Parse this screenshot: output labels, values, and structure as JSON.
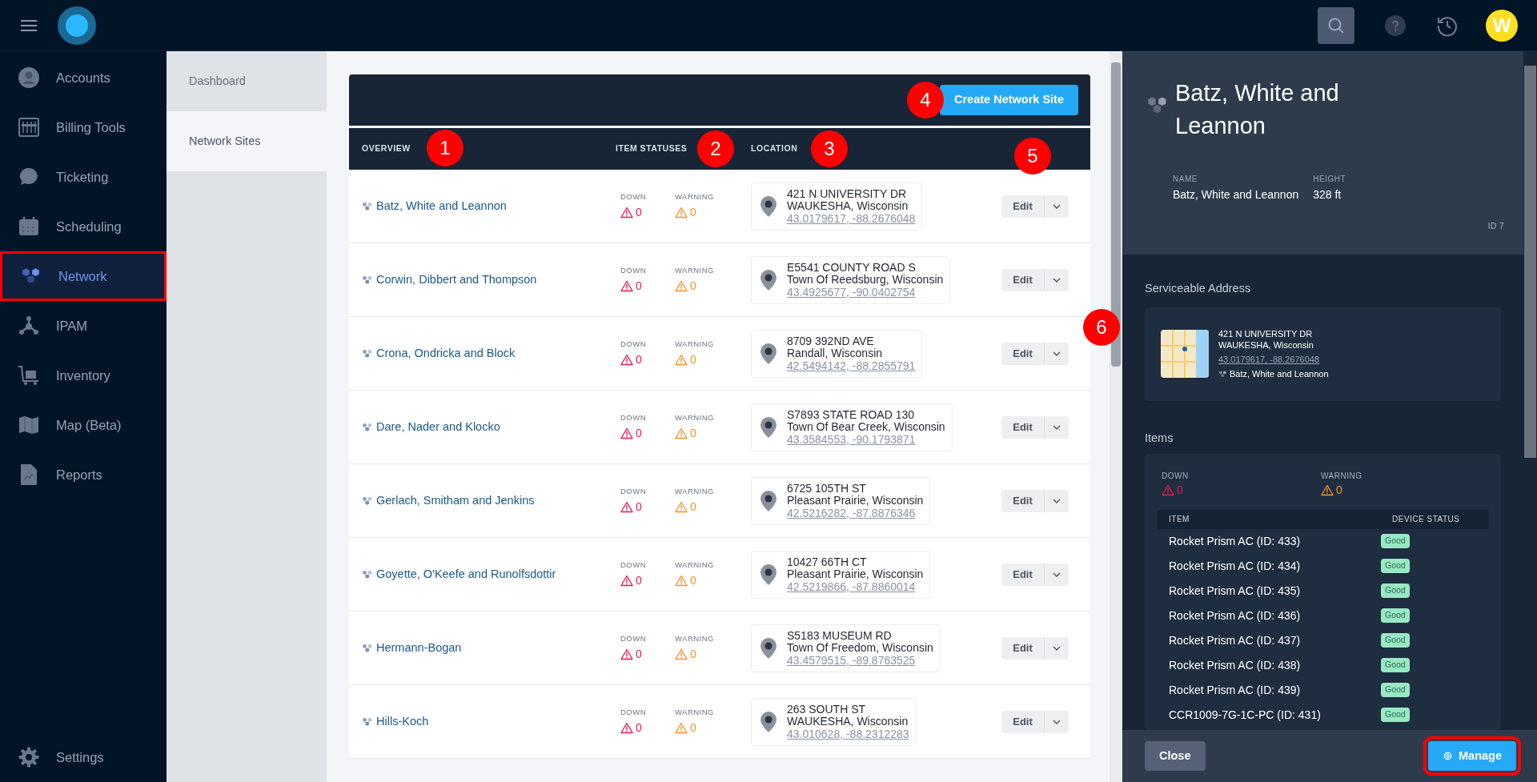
{
  "top_bar": {
    "avatar_initial": "W"
  },
  "sidebar": {
    "items": [
      {
        "kind": "accounts",
        "label": "Accounts",
        "selected": false,
        "annotated": false
      },
      {
        "kind": "billing",
        "label": "Billing Tools",
        "selected": false,
        "annotated": false
      },
      {
        "kind": "ticketing",
        "label": "Ticketing",
        "selected": false,
        "annotated": false
      },
      {
        "kind": "scheduling",
        "label": "Scheduling",
        "selected": false,
        "annotated": false
      },
      {
        "kind": "network",
        "label": "Network",
        "selected": true,
        "annotated": true
      },
      {
        "kind": "ipam",
        "label": "IPAM",
        "selected": false,
        "annotated": false
      },
      {
        "kind": "inventory",
        "label": "Inventory",
        "selected": false,
        "annotated": false
      },
      {
        "kind": "map",
        "label": "Map (Beta)",
        "selected": false,
        "annotated": false
      },
      {
        "kind": "reports",
        "label": "Reports",
        "selected": false,
        "annotated": false
      }
    ],
    "footer_item": {
      "kind": "settings",
      "label": "Settings"
    }
  },
  "subnav": {
    "items": [
      {
        "label": "Dashboard",
        "selected": false
      },
      {
        "label": "Network Sites",
        "selected": true
      }
    ]
  },
  "toolbar": {
    "create_button": "Create Network Site"
  },
  "table": {
    "columns": [
      "OVERVIEW",
      "ITEM STATUSES",
      "LOCATION"
    ],
    "rows": [
      {
        "name": "Batz, White and Leannon",
        "statuses": [
          {
            "kind": "down",
            "label": "DOWN",
            "count": "0"
          },
          {
            "kind": "warning",
            "label": "WARNING",
            "count": "0"
          }
        ],
        "address": [
          "421 N UNIVERSITY DR",
          "WAUKESHA, Wisconsin"
        ],
        "coordinates": "43.0179617, -88.2676048",
        "edit": "Edit"
      },
      {
        "name": "Corwin, Dibbert and Thompson",
        "statuses": [
          {
            "kind": "down",
            "label": "DOWN",
            "count": "0"
          },
          {
            "kind": "warning",
            "label": "WARNING",
            "count": "0"
          }
        ],
        "address": [
          "E5541 COUNTY ROAD S",
          "Town Of Reedsburg, Wisconsin"
        ],
        "coordinates": "43.4925677, -90.0402754",
        "edit": "Edit"
      },
      {
        "name": "Crona, Ondricka and Block",
        "statuses": [
          {
            "kind": "down",
            "label": "DOWN",
            "count": "0"
          },
          {
            "kind": "warning",
            "label": "WARNING",
            "count": "0"
          }
        ],
        "address": [
          "8709 392ND AVE",
          "Randall, Wisconsin"
        ],
        "coordinates": "42.5494142, -88.2855791",
        "edit": "Edit"
      },
      {
        "name": "Dare, Nader and Klocko",
        "statuses": [
          {
            "kind": "down",
            "label": "DOWN",
            "count": "0"
          },
          {
            "kind": "warning",
            "label": "WARNING",
            "count": "0"
          }
        ],
        "address": [
          "S7893 STATE ROAD 130",
          "Town Of Bear Creek, Wisconsin"
        ],
        "coordinates": "43.3584553, -90.1793871",
        "edit": "Edit"
      },
      {
        "name": "Gerlach, Smitham and Jenkins",
        "statuses": [
          {
            "kind": "down",
            "label": "DOWN",
            "count": "0"
          },
          {
            "kind": "warning",
            "label": "WARNING",
            "count": "0"
          }
        ],
        "address": [
          "6725 105TH ST",
          "Pleasant Prairie, Wisconsin"
        ],
        "coordinates": "42.5216282, -87.8876346",
        "edit": "Edit"
      },
      {
        "name": "Goyette, O'Keefe and Runolfsdottir",
        "statuses": [
          {
            "kind": "down",
            "label": "DOWN",
            "count": "0"
          },
          {
            "kind": "warning",
            "label": "WARNING",
            "count": "0"
          }
        ],
        "address": [
          "10427 66TH CT",
          "Pleasant Prairie, Wisconsin"
        ],
        "coordinates": "42.5219866, -87.8860014",
        "edit": "Edit"
      },
      {
        "name": "Hermann-Bogan",
        "statuses": [
          {
            "kind": "down",
            "label": "DOWN",
            "count": "0"
          },
          {
            "kind": "warning",
            "label": "WARNING",
            "count": "0"
          }
        ],
        "address": [
          "S5183 MUSEUM RD",
          "Town Of Freedom, Wisconsin"
        ],
        "coordinates": "43.4579515, -89.8763525",
        "edit": "Edit"
      },
      {
        "name": "Hills-Koch",
        "statuses": [
          {
            "kind": "down",
            "label": "DOWN",
            "count": "0"
          },
          {
            "kind": "warning",
            "label": "WARNING",
            "count": "0"
          }
        ],
        "address": [
          "263 SOUTH ST",
          "WAUKESHA, Wisconsin"
        ],
        "coordinates": "43.010628, -88.2312283",
        "edit": "Edit"
      }
    ]
  },
  "callouts": [
    "1",
    "2",
    "3",
    "4",
    "5",
    "6"
  ],
  "detail_panel": {
    "title": "Batz, White and Leannon",
    "fields": [
      {
        "label": "NAME",
        "value": "Batz, White and Leannon"
      },
      {
        "label": "HEIGHT",
        "value": "328 ft"
      }
    ],
    "id": "ID 7",
    "address_section": {
      "heading": "Serviceable Address",
      "lines": [
        "421 N UNIVERSITY DR",
        "WAUKESHA, Wisconsin"
      ],
      "coordinates": "43.0179617, -88.2676048",
      "site": "Batz, White and Leannon"
    },
    "items_section": {
      "heading": "Items",
      "statuses": [
        {
          "kind": "down",
          "label": "DOWN",
          "count": "0"
        },
        {
          "kind": "warning",
          "label": "WARNING",
          "count": "0"
        }
      ],
      "columns": [
        "ITEM",
        "DEVICE STATUS"
      ],
      "rows": [
        {
          "item": "Rocket Prism AC (ID: 433)",
          "status": "Good",
          "kind": "good"
        },
        {
          "item": "Rocket Prism AC (ID: 434)",
          "status": "Good",
          "kind": "good"
        },
        {
          "item": "Rocket Prism AC (ID: 435)",
          "status": "Good",
          "kind": "good"
        },
        {
          "item": "Rocket Prism AC (ID: 436)",
          "status": "Good",
          "kind": "good"
        },
        {
          "item": "Rocket Prism AC (ID: 437)",
          "status": "Good",
          "kind": "good"
        },
        {
          "item": "Rocket Prism AC (ID: 438)",
          "status": "Good",
          "kind": "good"
        },
        {
          "item": "Rocket Prism AC (ID: 439)",
          "status": "Good",
          "kind": "good"
        },
        {
          "item": "CCR1009-7G-1C-PC (ID: 431)",
          "status": "Good",
          "kind": "good"
        }
      ]
    },
    "close_button": "Close",
    "manage_button": {
      "label": "Manage",
      "annotated": true
    }
  }
}
